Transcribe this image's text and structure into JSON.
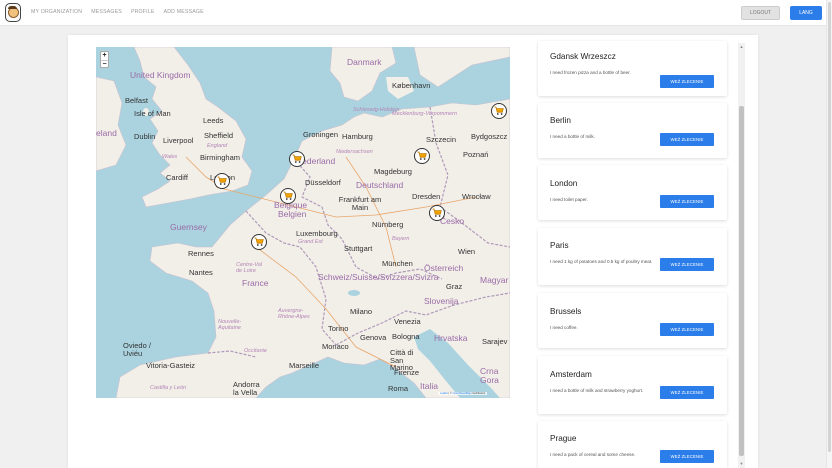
{
  "nav": {
    "links": [
      "MY ORGANIZATION",
      "MESSAGES",
      "PROFILE",
      "ADD MESSAGE"
    ],
    "logout_label": "LOGOUT",
    "lang_label": "LANG"
  },
  "map": {
    "zoom_in": "+",
    "zoom_out": "−",
    "attribution_leaflet": "Leaflet",
    "attribution_sep": " | © ",
    "attribution_osm": "OpenStreetMap",
    "attribution_end": " contributors",
    "labels": {
      "united_kingdom": "United Kingdom",
      "isle_of_man": "Isle of Man",
      "belfast": "Belfast",
      "leeds": "Leeds",
      "dublin": "Dublin",
      "liverpool": "Liverpool",
      "sheffield": "Sheffield",
      "ireland": "eland",
      "england": "England",
      "wales": "Wales",
      "birmingham": "Birmingham",
      "cardiff": "Cardiff",
      "london": "London",
      "danmark": "Danmark",
      "kobenhavn": "København",
      "schleswig": "Schleswig-Holstein",
      "mecklenburg": "Mecklenburg-Vorpommern",
      "groningen": "Groningen",
      "hamburg": "Hamburg",
      "szczecin": "Szczecin",
      "bydgoszcz": "Bydgoszcz",
      "niedersachsen": "Niedersachsen",
      "poznan": "Poznań",
      "nederland": "Nederland",
      "magdeburg": "Magdeburg",
      "dusseldorf": "Düsseldorf",
      "deutschland": "Deutschland",
      "dresden": "Dresden",
      "wroclaw": "Wrocław",
      "belgique": "Belgique",
      "belgien": "Belgien",
      "frankfurt": "Frankfurt am Main",
      "cesko": "Česko",
      "guernsey": "Guernsey",
      "luxembourg": "Luxembourg",
      "grand_est": "Grand Est",
      "nurnberg": "Nürnberg",
      "bayern": "Bayern",
      "rennes": "Rennes",
      "stuttgart": "Stuttgart",
      "wien": "Wien",
      "nantes": "Nantes",
      "centre_val": "Centre-Val de Loire",
      "munchen": "München",
      "osterreich": "Österreich",
      "france": "France",
      "schweiz": "Schweiz/Suisse/Svizzera/Svizra",
      "graz": "Graz",
      "magyar": "Magyar",
      "slovenija": "Slovenija",
      "auvergne": "Auvergne-Rhône-Alpes",
      "milano": "Milano",
      "nouvelle": "Nouvelle-Aquitaine",
      "torino": "Torino",
      "venezia": "Venezia",
      "hrvatska": "Hrvatska",
      "sarajevo": "Sarajev",
      "genova": "Genova",
      "bologna": "Bologna",
      "oviedo": "Oviedo / Uviéu",
      "occitanie": "Occitanie",
      "monaco": "Monaco",
      "san_marino": "Città di San Marino",
      "vitoria": "Vitoria-Gasteiz",
      "marseille": "Marseille",
      "firenze": "Firenze",
      "crna": "Crna Gora",
      "castilla": "Castilla y León",
      "andorra": "Andorra la Vella",
      "roma": "Roma",
      "italia": "Italia"
    }
  },
  "orders": [
    {
      "city": "Gdansk Wrzeszcz",
      "text": "I need frozen pizza and a bottle of beer.",
      "button": "WEŹ ZLECENIE"
    },
    {
      "city": "Berlin",
      "text": "I need a bottle of milk.",
      "button": "WEŹ ZLECENIE"
    },
    {
      "city": "London",
      "text": "I need toilet paper.",
      "button": "WEŹ ZLECENIE"
    },
    {
      "city": "Paris",
      "text": "I need 1 kg of potatoes and 0.5 kg of poultry meat.",
      "button": "WEŹ ZLECENIE"
    },
    {
      "city": "Brussels",
      "text": "I need coffee.",
      "button": "WEŹ ZLECENIE"
    },
    {
      "city": "Amsterdam",
      "text": "I need a bottle of milk and strawberry yoghurt.",
      "button": "WEŹ ZLECENIE"
    },
    {
      "city": "Prague",
      "text": "I need a pack of cereal and some cheese.",
      "button": "WEŹ ZLECENIE"
    }
  ],
  "colors": {
    "accent": "#2b7de9",
    "sea": "#aad3df",
    "land": "#f2efe9",
    "border": "#b09ab9"
  },
  "icons": {
    "marker": "shopping-cart-icon",
    "logo": "avatar-logo-icon"
  }
}
